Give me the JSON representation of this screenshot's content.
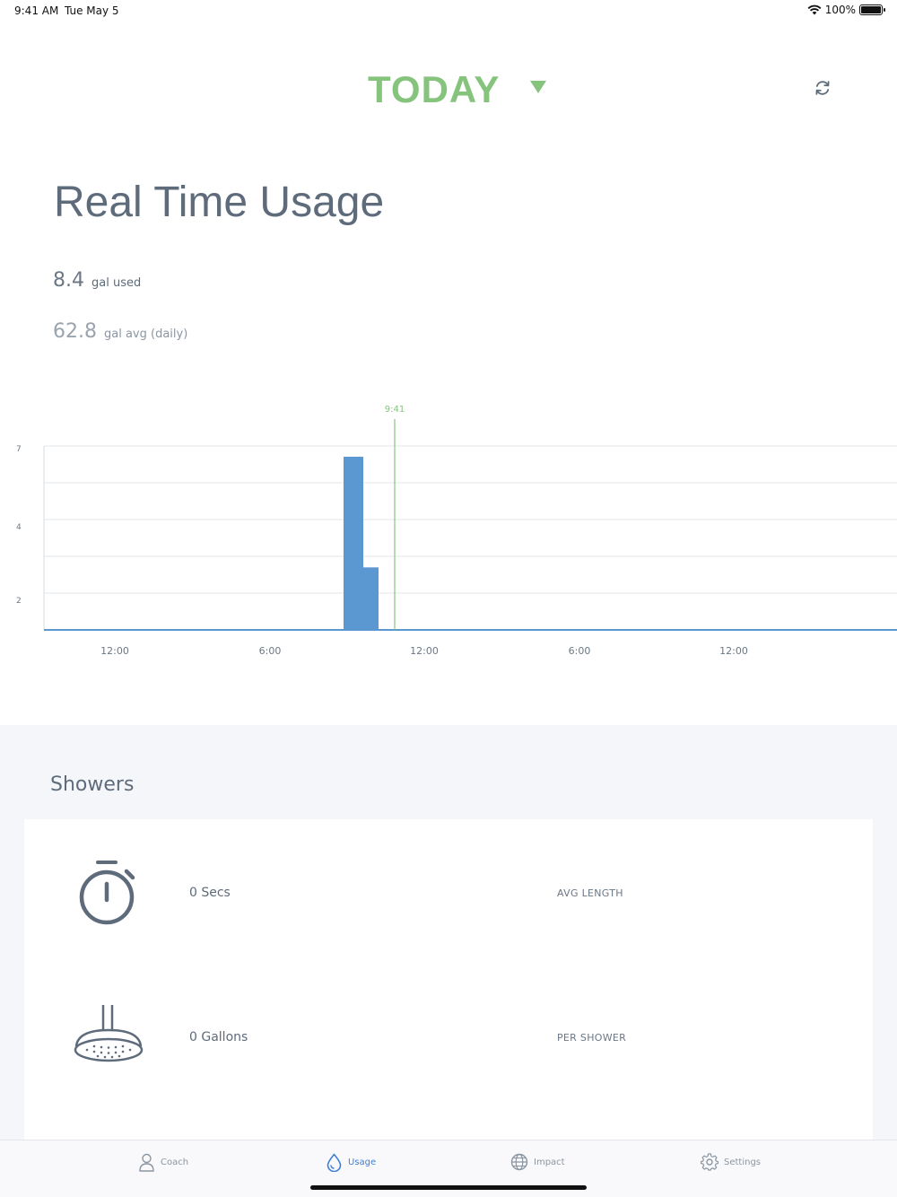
{
  "status_bar": {
    "time": "9:41 AM",
    "date": "Tue May 5",
    "battery": "100%",
    "battery_level": 1.0
  },
  "header": {
    "title": "TODAY",
    "accent_color": "#86c47e"
  },
  "usage": {
    "title": "Real Time Usage",
    "used_value": "8.4",
    "used_unit": "gal used",
    "avg_value": "62.8",
    "avg_unit": "gal avg (daily)"
  },
  "chart_data": {
    "type": "bar",
    "bar_color": "#5b97d1",
    "current_time_label": "9:41",
    "current_time_color": "#86c47e",
    "y_tick_labels": [
      "7",
      "4",
      "2"
    ],
    "x_tick_labels": [
      "12:00",
      "6:00",
      "12:00",
      "6:00",
      "12:00"
    ],
    "series": [
      {
        "values": [
          7.2,
          2.6
        ]
      }
    ]
  },
  "showers": {
    "title": "Showers",
    "rows": [
      {
        "icon": "stopwatch-icon",
        "value": "0 Secs",
        "label": "AVG LENGTH"
      },
      {
        "icon": "shower-head-icon",
        "value": "0 Gallons",
        "label": "PER SHOWER"
      }
    ]
  },
  "tabs": [
    {
      "label": "Coach",
      "icon": "person-icon",
      "active": false
    },
    {
      "label": "Usage",
      "icon": "water-drop-icon",
      "active": true
    },
    {
      "label": "Impact",
      "icon": "globe-icon",
      "active": false
    },
    {
      "label": "Settings",
      "icon": "gear-icon",
      "active": false
    }
  ]
}
